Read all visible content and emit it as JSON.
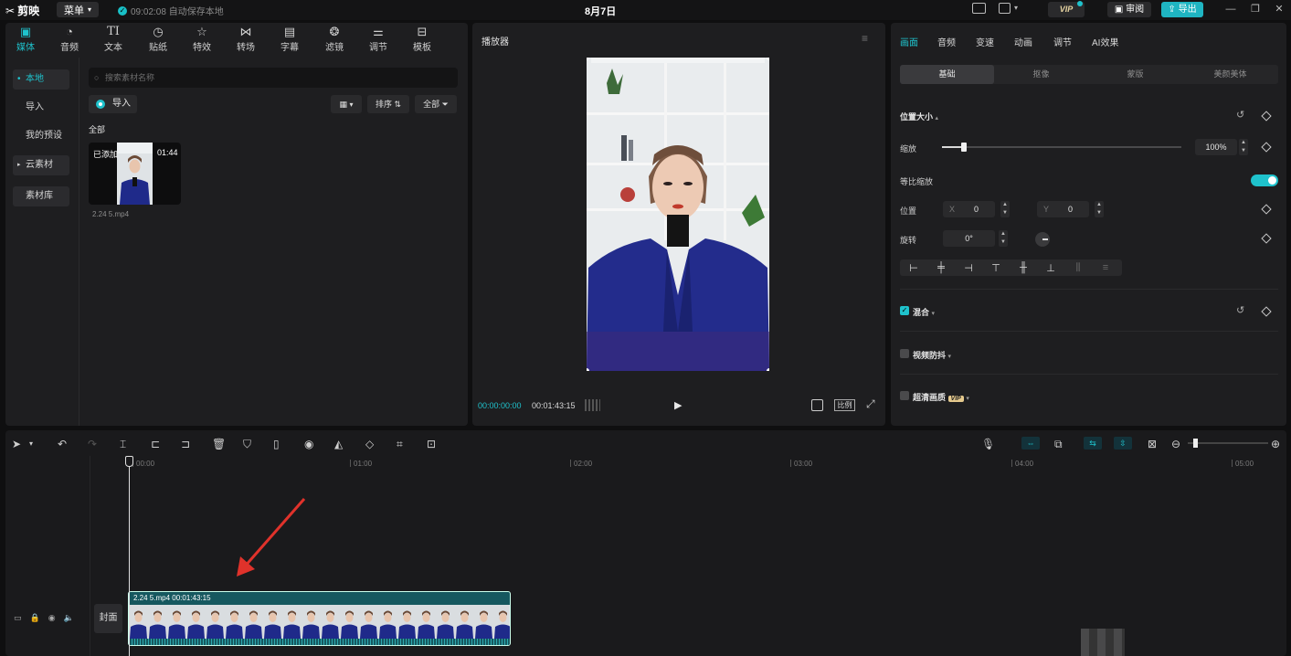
{
  "app": {
    "name": "剪映",
    "menu_label": "菜单",
    "autosave": "09:02:08 自动保存本地",
    "doc_title": "8月7日",
    "vip": "VIP",
    "review": "审阅",
    "export": "导出"
  },
  "media_tabs": [
    {
      "label": "媒体",
      "icon": "media-icon"
    },
    {
      "label": "音频",
      "icon": "audio-icon"
    },
    {
      "label": "文本",
      "icon": "text-icon"
    },
    {
      "label": "贴纸",
      "icon": "sticker-icon"
    },
    {
      "label": "特效",
      "icon": "effects-icon"
    },
    {
      "label": "转场",
      "icon": "transition-icon"
    },
    {
      "label": "字幕",
      "icon": "subtitle-icon"
    },
    {
      "label": "滤镜",
      "icon": "filter-icon"
    },
    {
      "label": "调节",
      "icon": "adjust-icon"
    },
    {
      "label": "模板",
      "icon": "template-icon"
    }
  ],
  "sidebar": {
    "local": "本地",
    "import": "导入",
    "presets": "我的预设",
    "cloud": "云素材",
    "library": "素材库"
  },
  "media": {
    "search_placeholder": "搜索素材名称",
    "import_label": "导入",
    "sort_label": "排序",
    "filter_label": "全部",
    "section_label": "全部",
    "clip": {
      "status": "已添加",
      "duration": "01:44",
      "filename": "2.24 5.mp4"
    }
  },
  "player": {
    "title": "播放器",
    "current_time": "00:00:00:00",
    "total_time": "00:01:43:15",
    "ratio_label": "比例"
  },
  "inspector": {
    "tabs": [
      "画面",
      "音频",
      "变速",
      "动画",
      "调节",
      "AI效果"
    ],
    "subtabs": [
      "基础",
      "抠像",
      "蒙版",
      "美颜美体"
    ],
    "position_size": "位置大小",
    "scale_label": "缩放",
    "scale_value": "100%",
    "scale_fraction": 0.09,
    "uniform_scale_label": "等比缩放",
    "position_label": "位置",
    "x_label": "X",
    "x_value": "0",
    "y_label": "Y",
    "y_value": "0",
    "rotation_label": "旋转",
    "rotation_value": "0°",
    "blend_label": "混合",
    "stabilize_label": "视频防抖",
    "hd_label": "超清画质",
    "hd_badge": "VIP"
  },
  "timeline": {
    "ruler": [
      "00:00",
      "01:00",
      "02:00",
      "03:00",
      "04:00",
      "05:00"
    ],
    "cover_label": "封面",
    "clip_label": "2.24 5.mp4   00:01:43:15"
  }
}
